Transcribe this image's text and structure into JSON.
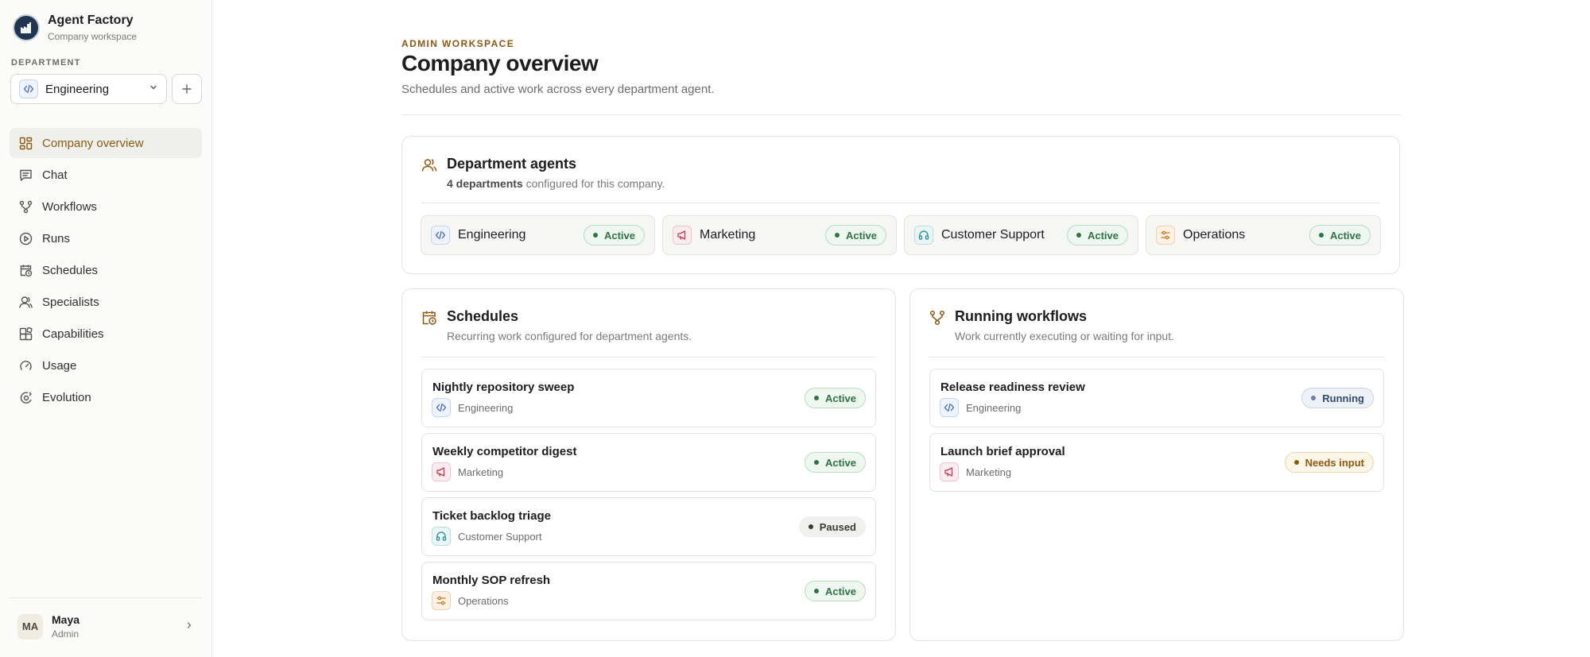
{
  "brand": {
    "name": "Agent Factory",
    "subtitle": "Company workspace"
  },
  "department": {
    "label": "DEPARTMENT",
    "selected": "Engineering"
  },
  "nav": [
    {
      "label": "Company overview",
      "icon": "grid-icon",
      "active": true
    },
    {
      "label": "Chat",
      "icon": "chat-icon"
    },
    {
      "label": "Workflows",
      "icon": "workflow-icon"
    },
    {
      "label": "Runs",
      "icon": "play-circle-icon"
    },
    {
      "label": "Schedules",
      "icon": "calendar-clock-icon"
    },
    {
      "label": "Specialists",
      "icon": "user-icon"
    },
    {
      "label": "Capabilities",
      "icon": "blocks-icon"
    },
    {
      "label": "Usage",
      "icon": "gauge-icon"
    },
    {
      "label": "Evolution",
      "icon": "evolution-icon"
    }
  ],
  "user": {
    "initials": "MA",
    "name": "Maya",
    "role": "Admin"
  },
  "header": {
    "eyebrow": "ADMIN WORKSPACE",
    "title": "Company overview",
    "subtitle": "Schedules and active work across every department agent."
  },
  "agents": {
    "title": "Department agents",
    "count": "4 departments",
    "subtitle_rest": " configured for this company.",
    "items": [
      {
        "name": "Engineering",
        "status": "Active"
      },
      {
        "name": "Marketing",
        "status": "Active"
      },
      {
        "name": "Customer Support",
        "status": "Active"
      },
      {
        "name": "Operations",
        "status": "Active"
      }
    ]
  },
  "schedules": {
    "title": "Schedules",
    "subtitle": "Recurring work configured for department agents.",
    "items": [
      {
        "title": "Nightly repository sweep",
        "department": "Engineering",
        "status": "Active"
      },
      {
        "title": "Weekly competitor digest",
        "department": "Marketing",
        "status": "Active"
      },
      {
        "title": "Ticket backlog triage",
        "department": "Customer Support",
        "status": "Paused"
      },
      {
        "title": "Monthly SOP refresh",
        "department": "Operations",
        "status": "Active"
      }
    ]
  },
  "workflows": {
    "title": "Running workflows",
    "subtitle": "Work currently executing or waiting for input.",
    "items": [
      {
        "title": "Release readiness review",
        "department": "Engineering",
        "status": "Running"
      },
      {
        "title": "Launch brief approval",
        "department": "Marketing",
        "status": "Needs input"
      }
    ]
  },
  "colors": {
    "accent": "#8a5a12",
    "active_green": "#2e7345",
    "running_blue": "#304a70",
    "engineering": "#3b68b8",
    "marketing": "#c23a52",
    "support": "#2a8c8e",
    "operations": "#c27a26"
  }
}
